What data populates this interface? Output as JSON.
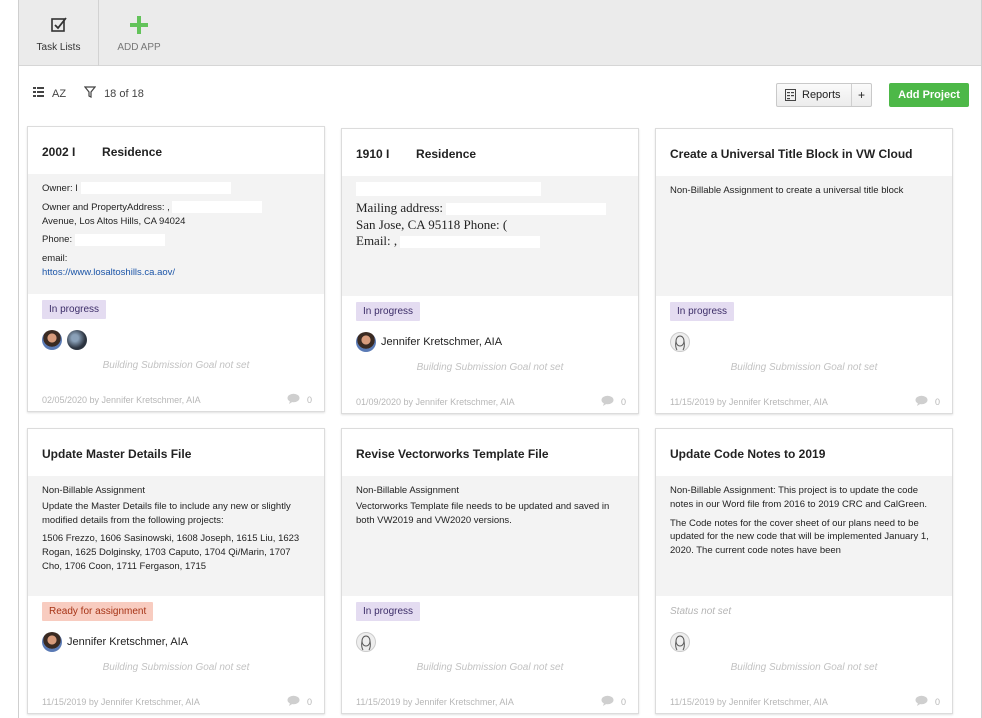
{
  "topbar": {
    "apps": [
      {
        "label": "Task Lists",
        "icon": "checkbox-icon"
      },
      {
        "label": "ADD APP",
        "icon": "plus-icon"
      }
    ]
  },
  "toolbar": {
    "sort_label": "AZ",
    "filter_count": "18 of 18",
    "reports_label": "Reports",
    "reports_plus": "+",
    "add_project_label": "Add Project"
  },
  "colors": {
    "accent_green": "#4db848",
    "status_progress_bg": "#e4dcf1",
    "status_ready_bg": "#f8ccc0"
  },
  "cards": [
    {
      "title": "2002 I        Residence",
      "lines": [
        "Owner: I",
        "Owner and PropertyAddress: ,",
        "Avenue, Los Altos Hills, CA 94024",
        "Phone:",
        "email:",
        "httos://www.losaltoshills.ca.aov/"
      ],
      "status": "In progress",
      "goal": "Building Submission Goal not set",
      "date": "02/05/2020 by Jennifer Kretschmer, AIA",
      "comments": "0"
    },
    {
      "title": "1910 I        Residence",
      "lines": [
        "Mailing address:",
        "San Jose, CA 95118 Phone: (",
        "Email: ,"
      ],
      "status": "In progress",
      "assignee": "Jennifer Kretschmer, AIA",
      "goal": "Building Submission Goal not set",
      "date": "01/09/2020 by Jennifer Kretschmer, AIA",
      "comments": "0"
    },
    {
      "title": "Create a Universal Title Block in VW Cloud",
      "lines": [
        "Non-Billable Assignment to create a universal title block"
      ],
      "status": "In progress",
      "goal": "Building Submission Goal not set",
      "date": "11/15/2019 by Jennifer Kretschmer, AIA",
      "comments": "0"
    },
    {
      "title": "Update Master Details File",
      "lines": [
        "Non-Billable Assignment",
        "Update the Master Details file to include any new or slightly modified details from the following projects:",
        "1506 Frezzo, 1606 Sasinowski, 1608 Joseph, 1615 Liu, 1623 Rogan, 1625 Dolginsky, 1703 Caputo, 1704 Qi/Marin, 1707 Cho, 1706 Coon, 1711 Fergason, 1715"
      ],
      "status": "Ready for assignment",
      "assignee": "Jennifer Kretschmer, AIA",
      "goal": "Building Submission Goal not set",
      "date": "11/15/2019 by Jennifer Kretschmer, AIA",
      "comments": "0"
    },
    {
      "title": "Revise Vectorworks Template File",
      "lines": [
        "Non-Billable Assignment",
        "Vectorworks Template file needs to be updated and saved in both VW2019 and VW2020 versions."
      ],
      "status": "In progress",
      "goal": "Building Submission Goal not set",
      "date": "11/15/2019 by Jennifer Kretschmer, AIA",
      "comments": "0"
    },
    {
      "title": "Update Code Notes to 2019",
      "lines": [
        "Non-Billable Assignment: This project is to update the code notes in our Word file from 2016 to 2019 CRC and CalGreen.",
        "The Code notes for the cover sheet of our plans need to be updated for the new code that will be implemented January 1, 2020. The current code notes have been"
      ],
      "status": "Status not set",
      "goal": "Building Submission Goal not set",
      "date": "11/15/2019 by Jennifer Kretschmer, AIA",
      "comments": "0"
    }
  ]
}
